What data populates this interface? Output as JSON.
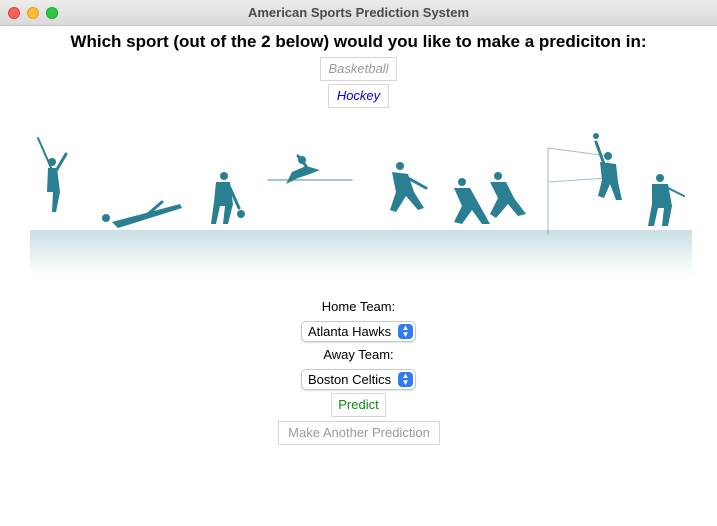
{
  "window": {
    "title": "American Sports Prediction System"
  },
  "heading": "Which sport (out of the 2 below) would you like to make a prediciton in:",
  "sports": {
    "basketball": "Basketball",
    "hockey": "Hockey"
  },
  "form": {
    "home_label": "Home Team:",
    "home_value": "Atlanta Hawks",
    "away_label": "Away Team:",
    "away_value": "Boston Celtics"
  },
  "actions": {
    "predict": "Predict",
    "another": "Make Another Prediction"
  },
  "colors": {
    "silhouette": "#2a7f93",
    "predict_text": "#0a8a0a",
    "hockey_text": "#0000ee",
    "disabled_text": "#9a9a9a",
    "select_accent": "#2f7cf6"
  },
  "icons": {
    "select_arrows": "up-down-chevron-icon"
  }
}
